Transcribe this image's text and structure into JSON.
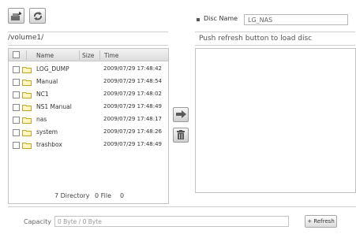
{
  "toolbar": {
    "upload_icon": "upload-icon",
    "refresh_icon": "refresh-cycle-icon"
  },
  "path": "/volume1/",
  "disc": {
    "label": "Disc Name",
    "value": "LG_NAS",
    "message": "Push refresh button to load disc"
  },
  "table": {
    "columns": {
      "name": "Name",
      "size": "Size",
      "time": "Time"
    },
    "rows": [
      {
        "name": "LOG_DUMP",
        "time": "2009/07/29 17:48:42"
      },
      {
        "name": "Manual",
        "time": "2009/07/29 17:48:54"
      },
      {
        "name": "NC1",
        "time": "2009/07/29 17:48:02"
      },
      {
        "name": "NS1 Manual",
        "time": "2009/07/29 17:48:49"
      },
      {
        "name": "nas",
        "time": "2009/07/29 17:48:17"
      },
      {
        "name": "system",
        "time": "2009/07/29 17:48:26"
      },
      {
        "name": "trashbox",
        "time": "2009/07/29 17:48:49"
      }
    ],
    "dir_count": "7 Directory",
    "file_count": "0 File",
    "size_total": "0"
  },
  "capacity": {
    "label": "Capacity",
    "value": "0 Byte / 0 Byte"
  },
  "refresh_label": "+ Refresh"
}
